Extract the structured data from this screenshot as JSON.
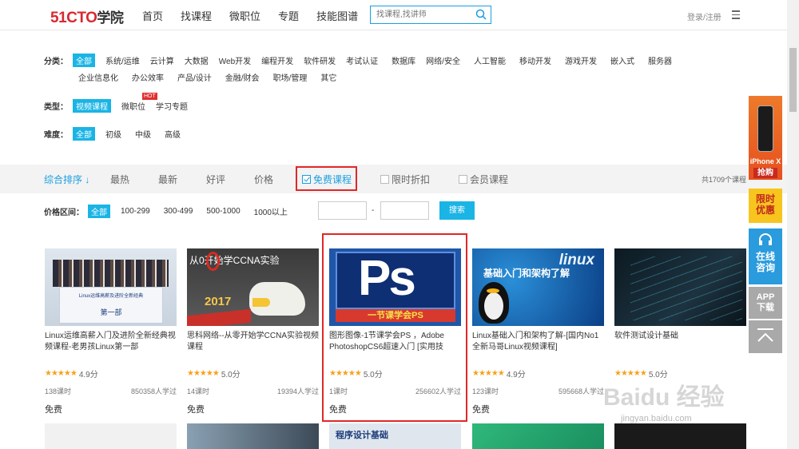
{
  "header": {
    "logo_brand": "51CTO",
    "logo_cn": "学院",
    "nav": [
      "首页",
      "找课程",
      "微职位",
      "专题",
      "技能图谱"
    ],
    "search_placeholder": "找课程,找讲师",
    "login": "登录/注册"
  },
  "filters": {
    "category_label": "分类：",
    "category_row1": [
      "全部",
      "系统/运维",
      "云计算",
      "大数据",
      "Web开发",
      "编程开发",
      "软件研发",
      "考试认证",
      "数据库",
      "网络/安全",
      "人工智能",
      "移动开发",
      "游戏开发",
      "嵌入式",
      "服务器"
    ],
    "category_row2": [
      "企业信息化",
      "办公效率",
      "产品/设计",
      "金融/财会",
      "职场/管理",
      "其它"
    ],
    "type_label": "类型：",
    "types": [
      "视频课程",
      "微职位",
      "学习专题"
    ],
    "hot_badge": "HOT",
    "difficulty_label": "难度：",
    "difficulties": [
      "全部",
      "初级",
      "中级",
      "高级"
    ]
  },
  "sort": {
    "items": [
      "综合排序",
      "最热",
      "最新",
      "好评",
      "价格"
    ],
    "arrow": "↓",
    "checks": [
      "免费课程",
      "限时折扣",
      "会员课程"
    ],
    "total": "共1709个课程"
  },
  "price": {
    "label": "价格区间：",
    "options": [
      "全部",
      "100-299",
      "300-499",
      "500-1000",
      "1000以上"
    ],
    "dash": "-",
    "search_btn": "搜索"
  },
  "courses": [
    {
      "title": "Linux运维高薪入门及进阶全新经典视频课程-老男孩Linux第一部",
      "rating": "4.9分",
      "lessons": "138课时",
      "learners": "850358人学过",
      "price": "免费",
      "thumb_text": "Linux运维高薪及进阶全新经典",
      "thumb_sub": "第一部"
    },
    {
      "title": "思科网络--从零开始学CCNA实验视频课程",
      "rating": "5.0分",
      "lessons": "14课时",
      "learners": "19394人学过",
      "price": "免费",
      "thumb_text": "从0开始学CCNA实验",
      "thumb_sub": "2017"
    },
    {
      "title": "图形图像-1节课学会PS ，Adobe PhotoshopCS6超速入门 [实用技",
      "rating": "5.0分",
      "lessons": "1课时",
      "learners": "256602人学过",
      "price": "免费",
      "thumb_text": "Ps",
      "thumb_sub": "一节课学会PS"
    },
    {
      "title": "Linux基础入门和架构了解-[国内No1全新马哥Linux视频课程]",
      "rating": "4.9分",
      "lessons": "123课时",
      "learners": "595668人学过",
      "price": "免费",
      "thumb_text": "linux",
      "thumb_sub": "基础入门和架构了解"
    },
    {
      "title": "软件测试设计基础",
      "rating": "5.0分",
      "lessons": "",
      "learners": "",
      "price": "",
      "thumb_text": "",
      "thumb_sub": ""
    }
  ],
  "row2": {
    "thumb_text": "程序设计基础"
  },
  "side": {
    "iphone": "iPhone X",
    "grab": "抢购",
    "promo": "限时优惠",
    "consult": "在线咨询",
    "app": "APP下载"
  },
  "watermark": {
    "main": "Baidu 经验",
    "url": "jingyan.baidu.com"
  }
}
